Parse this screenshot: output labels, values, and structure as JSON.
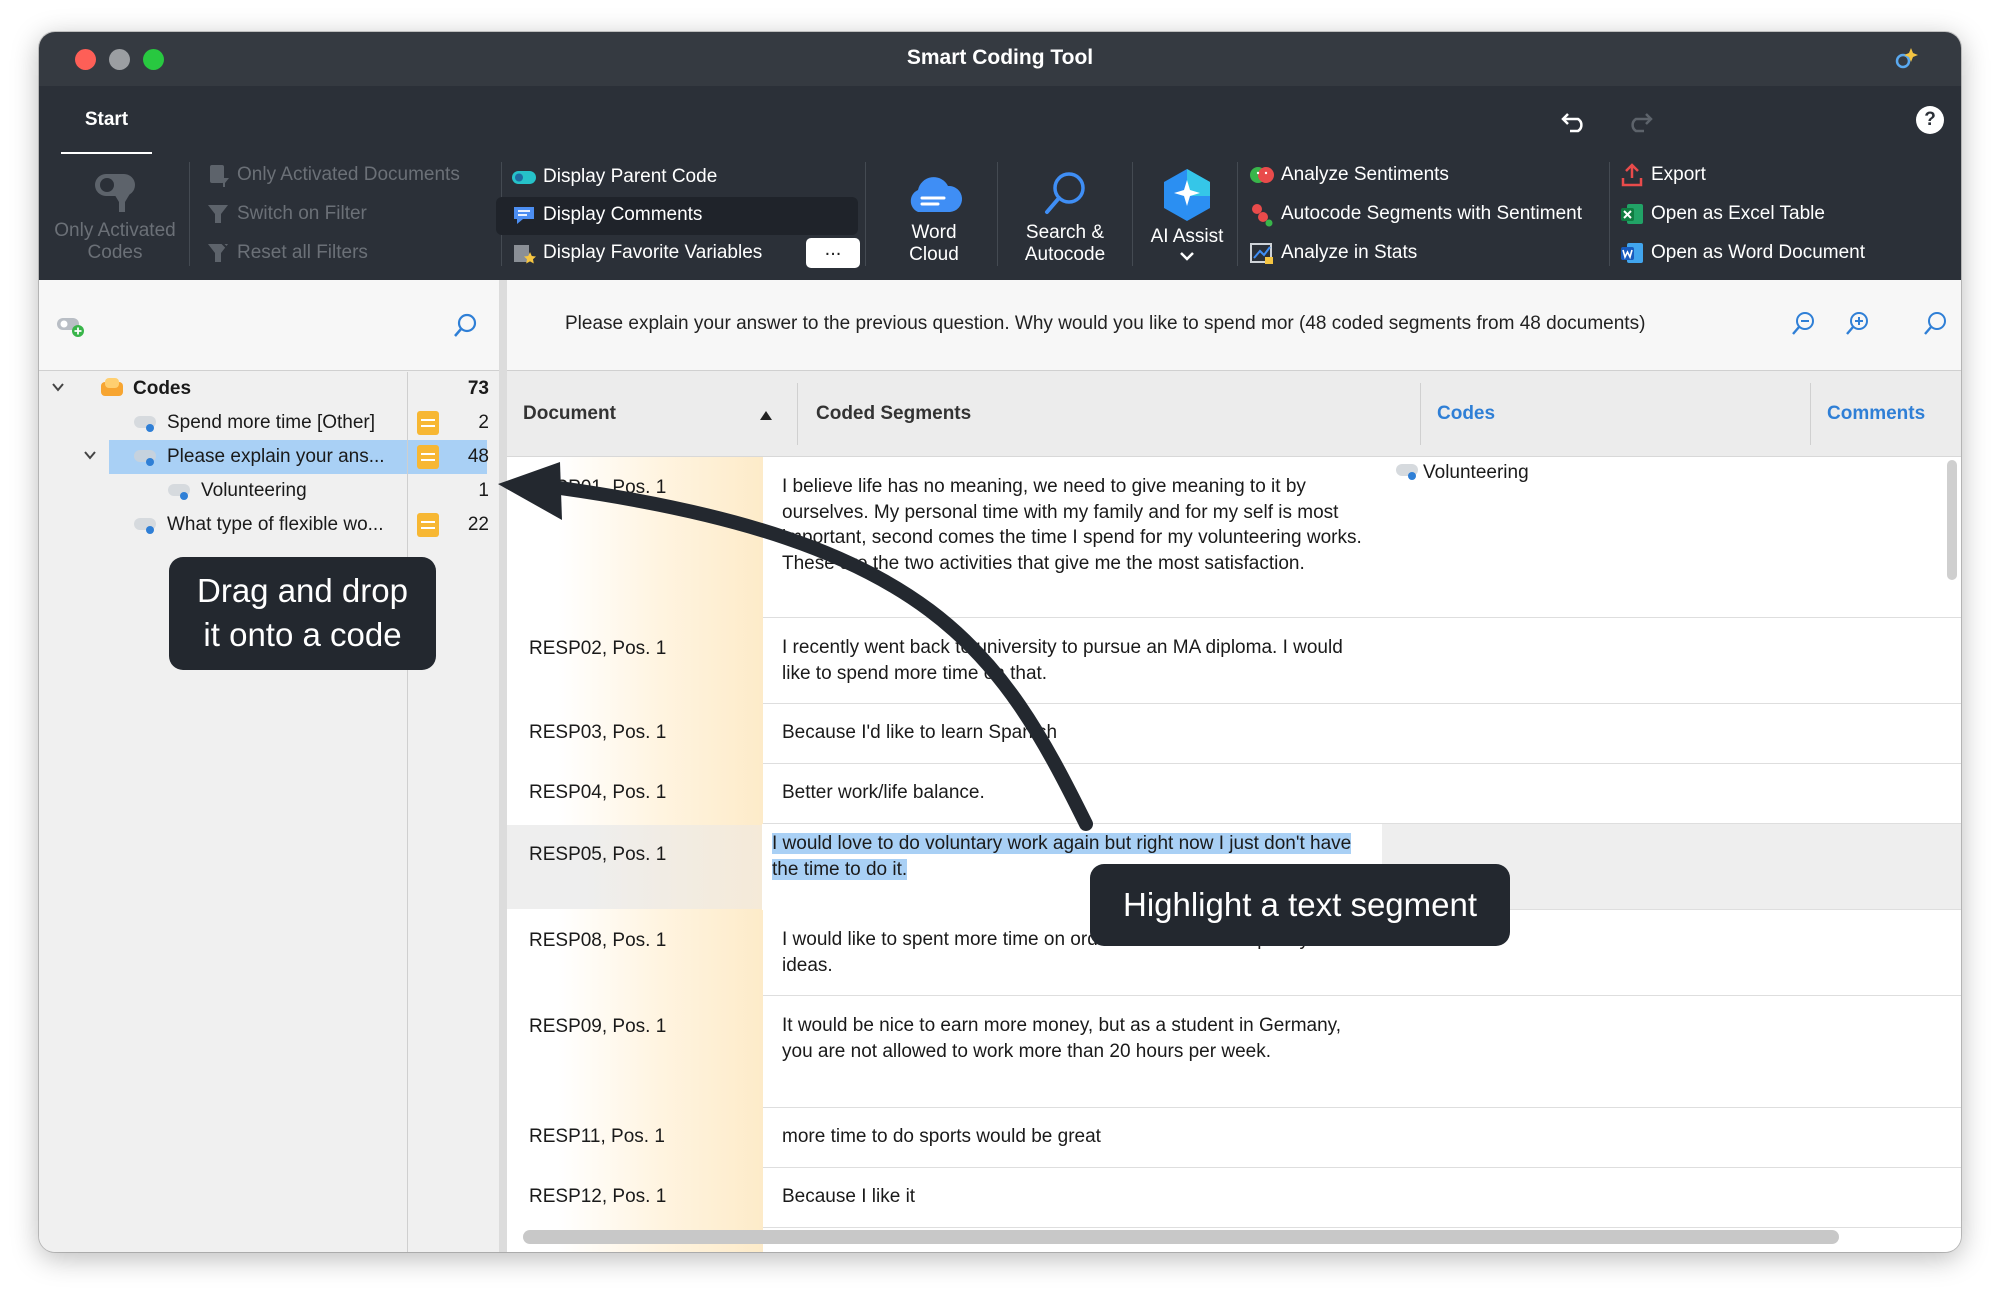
{
  "window": {
    "title": "Smart Coding Tool"
  },
  "tabs": {
    "start": "Start",
    "help": "?"
  },
  "ribbon": {
    "only_activated_codes": "Only Activated Codes",
    "only_activated_documents": "Only Activated Documents",
    "switch_on_filter": "Switch on Filter",
    "reset_all_filters": "Reset all Filters",
    "display_parent_code": "Display Parent Code",
    "display_comments": "Display Comments",
    "display_favorite_variables": "Display Favorite Variables",
    "more": "...",
    "word_cloud_1": "Word",
    "word_cloud_2": "Cloud",
    "search_autocode_1": "Search &",
    "search_autocode_2": "Autocode",
    "ai_assist": "AI Assist",
    "analyze_sentiments": "Analyze Sentiments",
    "autocode_sentiment": "Autocode Segments with Sentiment",
    "analyze_in_stats": "Analyze in Stats",
    "export": "Export",
    "open_excel": "Open as Excel Table",
    "open_word": "Open as Word Document"
  },
  "codes_tree": {
    "root": {
      "label": "Codes",
      "count": "73"
    },
    "items": [
      {
        "label": "Spend more time [Other]",
        "count": "2"
      },
      {
        "label": "Please explain your ans...",
        "count": "48"
      },
      {
        "label": "Volunteering",
        "count": "1"
      },
      {
        "label": "What type of flexible wo...",
        "count": "22"
      }
    ]
  },
  "info_bar": {
    "text": "Please explain your answer to the previous question. Why would you like to spend mor (48 coded segments from 48 documents)"
  },
  "table": {
    "headers": {
      "document": "Document",
      "coded_segments": "Coded Segments",
      "codes": "Codes",
      "comments": "Comments"
    },
    "rows": [
      {
        "doc": "RESP01, Pos. 1",
        "segment": "I believe life has no meaning, we need to give meaning to it by ourselves. My personal time with my family and for my self is most important, second comes the time I spend for my volunteering works. These are the two activities that give me the most satisfaction.",
        "code": "Volunteering"
      },
      {
        "doc": "RESP02, Pos. 1",
        "segment": "I recently went back to university to pursue an MA diploma. I would like to spend more time on that."
      },
      {
        "doc": "RESP03, Pos. 1",
        "segment": "Because I'd like to learn Spanish"
      },
      {
        "doc": "RESP04, Pos. 1",
        "segment": "Better work/life balance."
      },
      {
        "doc": "RESP05, Pos. 1",
        "segment": "I would love to do voluntary work again but right now I just don't have the time to do it."
      },
      {
        "doc": "RESP08, Pos. 1",
        "segment": "I would like to spent more time on order to further develope my ideas."
      },
      {
        "doc": "RESP09, Pos. 1",
        "segment": "It would be nice to earn more money, but as a student in Germany, you are not allowed to work more than 20 hours per week."
      },
      {
        "doc": "RESP11, Pos. 1",
        "segment": "more time to do sports would be great"
      },
      {
        "doc": "RESP12, Pos. 1",
        "segment": "Because I like it"
      }
    ]
  },
  "callouts": {
    "drag_line1": "Drag and drop",
    "drag_line2": "it onto a code",
    "highlight": "Highlight a text segment"
  },
  "colors": {
    "accent": "#2f7fd6",
    "memo": "#f7b733",
    "selection": "#a9d0f5",
    "callout": "#23282f"
  }
}
